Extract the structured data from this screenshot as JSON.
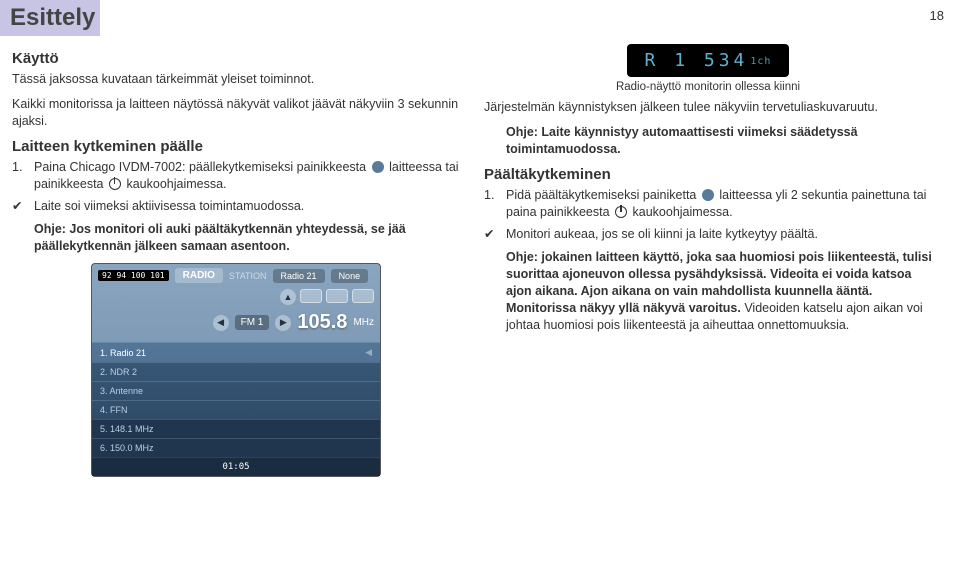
{
  "page_number": "18",
  "title": "Esittely",
  "left": {
    "h_kaytto": "Käyttö",
    "intro1": "Tässä jaksossa kuvataan tärkeimmät yleiset toiminnot.",
    "intro2": "Kaikki monitorissa ja laitteen näytössä näkyvät valikot jäävät näkyviin 3 sekunnin ajaksi.",
    "h_on": "Laitteen kytkeminen päälle",
    "on_num": "1.",
    "on_text_a": "Paina Chicago IVDM-7002: päällekytkemiseksi painikkeesta",
    "on_text_b": "laitteessa tai painikkeesta",
    "on_text_c": "kauko­ohjaimessa.",
    "check1": "Laite soi viimeksi aktiivisessa toimintamuodossa.",
    "note1": "Ohje: Jos monitori oli auki päältäkytkennän yhteydessä, se jää päällekytkennän jälkeen samaan asentoon."
  },
  "radio_ui": {
    "freq_strip": "92 94 100 101",
    "radio_label": "RADIO",
    "station_word": "STATION",
    "station_name": "Radio 21",
    "none": "None",
    "band": "FM 1",
    "freq": "105.8",
    "unit": "MHz",
    "presets": [
      "1. Radio 21",
      "2. NDR 2",
      "3. Antenne",
      "4. FFN",
      "5. 148.1 MHz",
      "6. 150.0 MHz"
    ],
    "clock": "01:05"
  },
  "lcd": {
    "text": "R 1  534",
    "suffix": "1ch",
    "caption": "Radio-näyttö monitorin ollessa kiinni"
  },
  "right": {
    "welcome": "Järjestelmän käynnistyksen jälkeen tulee näkyviin tervetuliaskuvaruutu.",
    "note2": "Ohje: Laite käynnistyy automaattisesti viimeksi säädetyssä toimintamuodossa.",
    "h_off": "Päältäkytkeminen",
    "off_num": "1.",
    "off_text_a": "Pidä päältäkytkemiseksi painiketta",
    "off_text_b": "laitteessa yli 2 sekuntia painettuna tai paina painikkeesta",
    "off_text_c": "kauko­ohjaimessa.",
    "check2": "Monitori aukeaa, jos se oli kiinni ja laite kytkeytyy päältä.",
    "note3_a": "Ohje: jokainen laitteen käyttö, joka saa huomiosi pois liikenteestä, tulisi suorittaa ajoneuvon ollessa pysähdyksissä. Videoita ei voida katsoa ajon aikana. Ajon aikana on vain mahdollista kuunnella ääntä. Monitorissa näkyy yllä näkyvä varoitus.",
    "note3_b": "Videoiden katselu ajon aikan voi johtaa huomiosi pois liikenteestä ja aiheuttaa onnettomuuksia."
  },
  "checkmark": "✔"
}
